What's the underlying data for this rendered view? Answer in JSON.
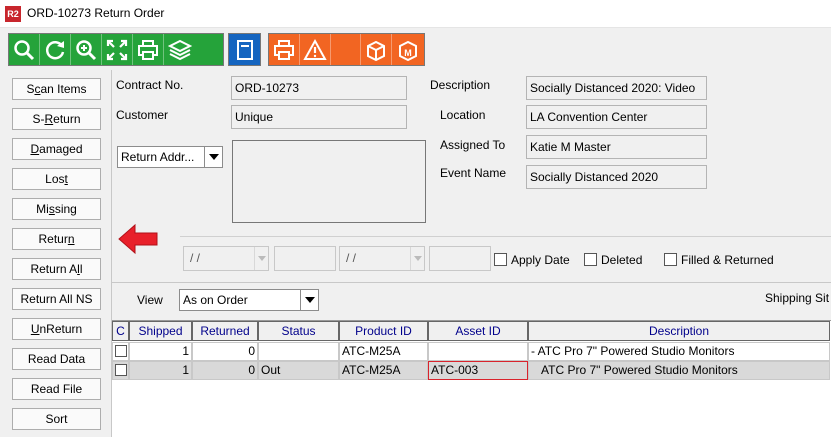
{
  "window": {
    "app_icon_text": "R2",
    "title": "ORD-10273 Return Order"
  },
  "toolbar": {
    "buttons": [
      "search-icon",
      "refresh-icon",
      "zoom-in-icon",
      "fit-screen-icon",
      "print-icon",
      "stack-icon",
      "book-icon",
      "print-icon",
      "warning-icon",
      "box-edit-icon",
      "box-m-icon"
    ]
  },
  "side_buttons": [
    {
      "pre": "S",
      "u": "c",
      "post": "an Items"
    },
    {
      "pre": "S-",
      "u": "R",
      "post": "eturn"
    },
    {
      "pre": "",
      "u": "D",
      "post": "amaged"
    },
    {
      "pre": "Los",
      "u": "t",
      "post": ""
    },
    {
      "pre": "Mi",
      "u": "s",
      "post": "sing"
    },
    {
      "pre": "Retur",
      "u": "n",
      "post": ""
    },
    {
      "pre": "Return A",
      "u": "l",
      "post": "l"
    },
    {
      "pre": "Return All NS",
      "u": "",
      "post": ""
    },
    {
      "pre": "",
      "u": "U",
      "post": "nReturn"
    },
    {
      "pre": "Read Data",
      "u": "",
      "post": ""
    },
    {
      "pre": "Read File",
      "u": "",
      "post": ""
    },
    {
      "pre": "Sort",
      "u": "",
      "post": ""
    }
  ],
  "form": {
    "contract_label": "Contract No.",
    "contract_value": "ORD-10273",
    "customer_label": "Customer",
    "customer_value": "Unique",
    "description_label": "Description",
    "description_value": "Socially Distanced 2020: Video",
    "location_label": "Location",
    "location_value": "LA Convention Center",
    "assigned_label": "Assigned To",
    "assigned_value": "Katie M Master",
    "event_label": "Event Name",
    "event_value": "Socially Distanced 2020",
    "address_combo": "Return Addr..."
  },
  "dates": {
    "date1": "/ /",
    "date2": "/ /"
  },
  "checkboxes": {
    "apply_date": "Apply Date",
    "deleted": "Deleted",
    "filled_returned": "Filled & Returned"
  },
  "view": {
    "label": "View",
    "value": "As on Order",
    "shipping_label": "Shipping Sit"
  },
  "table": {
    "headers": [
      "C",
      "Shipped",
      "Returned",
      "Status",
      "Product ID",
      "Asset ID",
      "Description"
    ],
    "rows": [
      {
        "shipped": "1",
        "returned": "0",
        "status": "",
        "product": "ATC-M25A",
        "asset": "",
        "description": "- ATC Pro 7\" Powered Studio Monitors"
      },
      {
        "shipped": "1",
        "returned": "0",
        "status": "Out",
        "product": "ATC-M25A",
        "asset": "ATC-003",
        "description": "ATC Pro 7\" Powered Studio Monitors"
      }
    ]
  },
  "colors": {
    "arrow": "#e8202a",
    "green": "#25a33a",
    "blue": "#1565c0",
    "orange": "#f26522"
  }
}
